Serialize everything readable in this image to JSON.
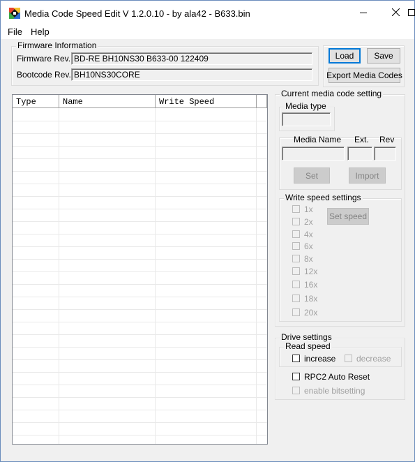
{
  "window": {
    "title": "Media Code Speed Edit V 1.2.0.10 - by ala42 - B633.bin",
    "controls": {
      "minimize": "minimize-icon",
      "maximize": "maximize-icon",
      "close": "close-icon"
    }
  },
  "menu": {
    "items": [
      {
        "label": "File"
      },
      {
        "label": "Help"
      }
    ]
  },
  "firmware": {
    "legend": "Firmware Information",
    "rev_label": "Firmware Rev.",
    "rev_value": "BD-RE  BH10NS30  B633-00 122409",
    "bootcode_label": "Bootcode Rev.",
    "bootcode_value": "BH10NS30CORE"
  },
  "buttons": {
    "load": "Load",
    "save": "Save",
    "export": "Export Media Codes"
  },
  "list": {
    "columns": [
      "Type",
      "Name",
      "Write Speed"
    ],
    "rows": []
  },
  "media_code": {
    "legend": "Current media code setting",
    "media_type_legend": "Media type",
    "media_type_value": "",
    "media_name_label": "Media Name",
    "ext_label": "Ext.",
    "rev_label": "Rev",
    "set_button": "Set",
    "import_button": "Import"
  },
  "write_speed": {
    "legend": "Write speed settings",
    "speeds": [
      "1x",
      "2x",
      "4x",
      "6x",
      "8x",
      "12x",
      "16x",
      "18x",
      "20x"
    ],
    "set_speed_button": "Set speed"
  },
  "drive": {
    "legend": "Drive settings",
    "read_speed_legend": "Read speed",
    "increase_label": "increase",
    "decrease_label": "decrease",
    "rpc2_label": "RPC2 Auto Reset",
    "bitsetting_label": "enable bitsetting"
  }
}
